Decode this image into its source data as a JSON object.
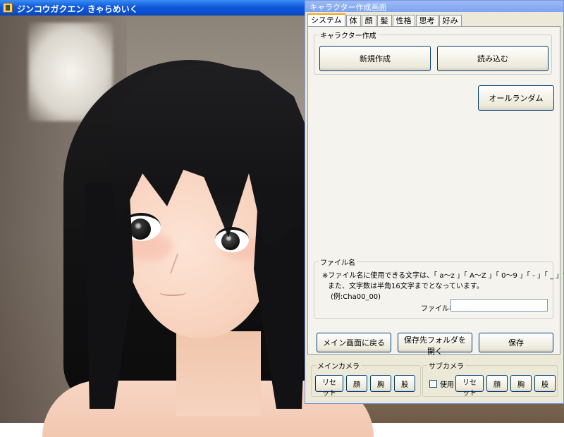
{
  "window": {
    "title": "ジンコウガクエン きゃらめいく"
  },
  "dialog": {
    "title": "キャラクター作成画面",
    "tabs": [
      "システム",
      "体",
      "顔",
      "髪",
      "性格",
      "思考",
      "好み"
    ],
    "active_tab": "システム",
    "character_group": {
      "legend": "キャラクター作成",
      "new_button": "新規作成",
      "load_button": "読み込む"
    },
    "all_random_button": "オールランダム",
    "filename_group": {
      "legend": "ファイル名",
      "note_line1": "※ファイル名に使用できる文字は、「 a〜z 」「 A〜Z 」「 0〜9 」「 - 」「 _ 」です。",
      "note_line2": "また、文字数は半角16文字までとなっています。",
      "note_line3": "(例:Cha00_00)",
      "field_label": "ファイル名:",
      "field_value": ""
    },
    "bottom_buttons": {
      "back_to_main": "メイン画面に戻る",
      "open_save_folder": "保存先フォルダを開く",
      "save": "保存"
    },
    "main_camera": {
      "legend": "メインカメラ",
      "reset": "リセット",
      "face": "顔",
      "chest": "胸",
      "legs": "股"
    },
    "sub_camera": {
      "legend": "サブカメラ",
      "use_label": "使用",
      "use_checked": false,
      "reset": "リセット",
      "face": "顔",
      "chest": "胸",
      "legs": "股"
    }
  },
  "colors": {
    "titlebar": "#0a4fcf",
    "dialog_bg": "#ece9d8",
    "tab_highlight": "#f5a623"
  }
}
